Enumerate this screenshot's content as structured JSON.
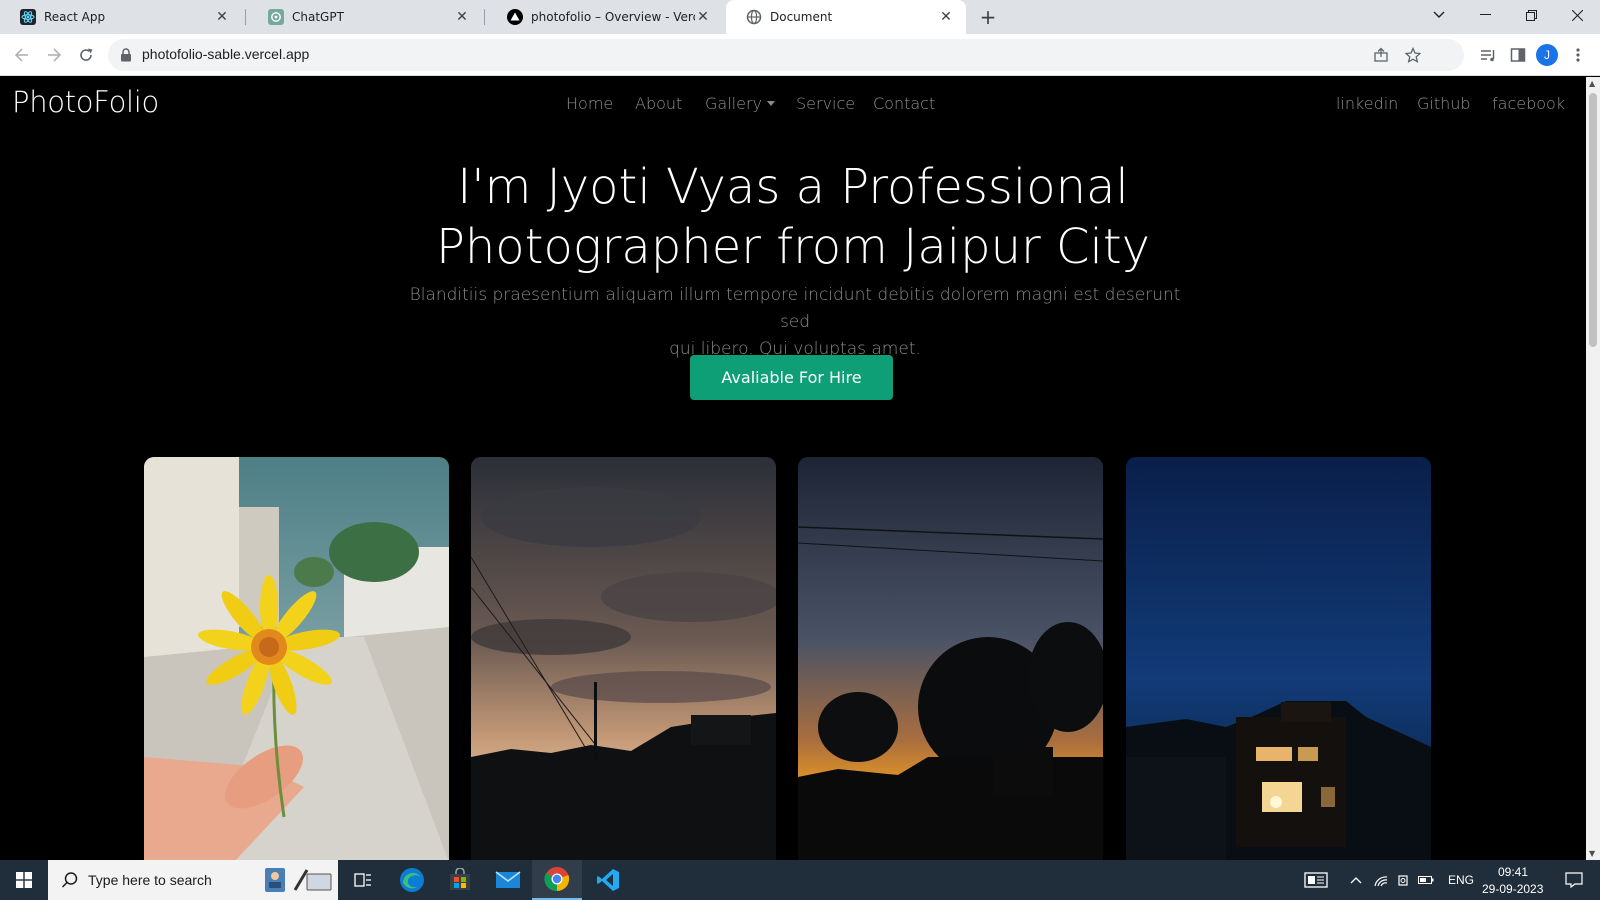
{
  "browser": {
    "tabs": [
      {
        "title": "React App",
        "icon": "react-icon",
        "active": false
      },
      {
        "title": "ChatGPT",
        "icon": "chatgpt-icon",
        "active": false
      },
      {
        "title": "photofolio – Overview - Vercel",
        "icon": "vercel-icon",
        "active": false
      },
      {
        "title": "Document",
        "icon": "globe-icon",
        "active": true
      }
    ],
    "new_tab_label": "+",
    "url": "photofolio-sable.vercel.app",
    "profile_initial": "J"
  },
  "site": {
    "brand": "PhotoFolio",
    "nav": [
      {
        "label": "Home"
      },
      {
        "label": "About"
      },
      {
        "label": "Gallery",
        "dropdown": true
      },
      {
        "label": "Service"
      },
      {
        "label": "Contact"
      }
    ],
    "social": [
      {
        "label": "linkedin"
      },
      {
        "label": "Github"
      },
      {
        "label": "facebook"
      }
    ],
    "hero": {
      "title_line1": "I'm Jyoti Vyas a Professional",
      "title_line2": "Photographer from Jaipur City",
      "text_line1": "Blanditiis praesentium aliquam illum tempore incidunt debitis dolorem magni est deserunt sed",
      "text_line2": "qui libero. Qui voluptas amet.",
      "button_label": "Avaliable For Hire"
    },
    "gallery": [
      {
        "subject": "yellow flower in hand"
      },
      {
        "subject": "cloudy sunset sky"
      },
      {
        "subject": "sunset behind trees"
      },
      {
        "subject": "house at night"
      }
    ],
    "accent_color": "#0e9f76"
  },
  "taskbar": {
    "search_placeholder": "Type here to search",
    "language": "ENG",
    "time": "09:41",
    "date": "29-09-2023"
  }
}
